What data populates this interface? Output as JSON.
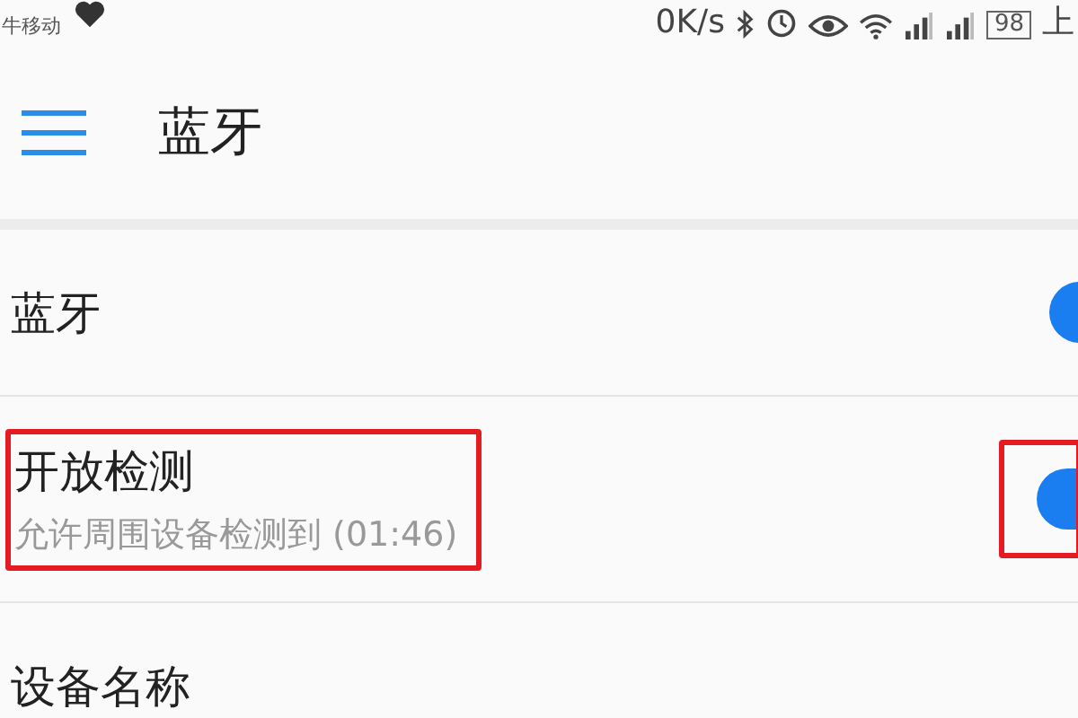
{
  "status_bar": {
    "carrier": "牛移动",
    "speed": "0K/s",
    "battery": "98",
    "extra": "上"
  },
  "header": {
    "title": "蓝牙"
  },
  "settings": [
    {
      "kind": "toggle",
      "title": "蓝牙",
      "on": true,
      "highlighted": false
    },
    {
      "kind": "toggle",
      "title": "开放检测",
      "subtitle": "允许周围设备检测到 (01:46)",
      "on": true,
      "highlighted": true
    },
    {
      "kind": "link",
      "title": "设备名称"
    }
  ]
}
